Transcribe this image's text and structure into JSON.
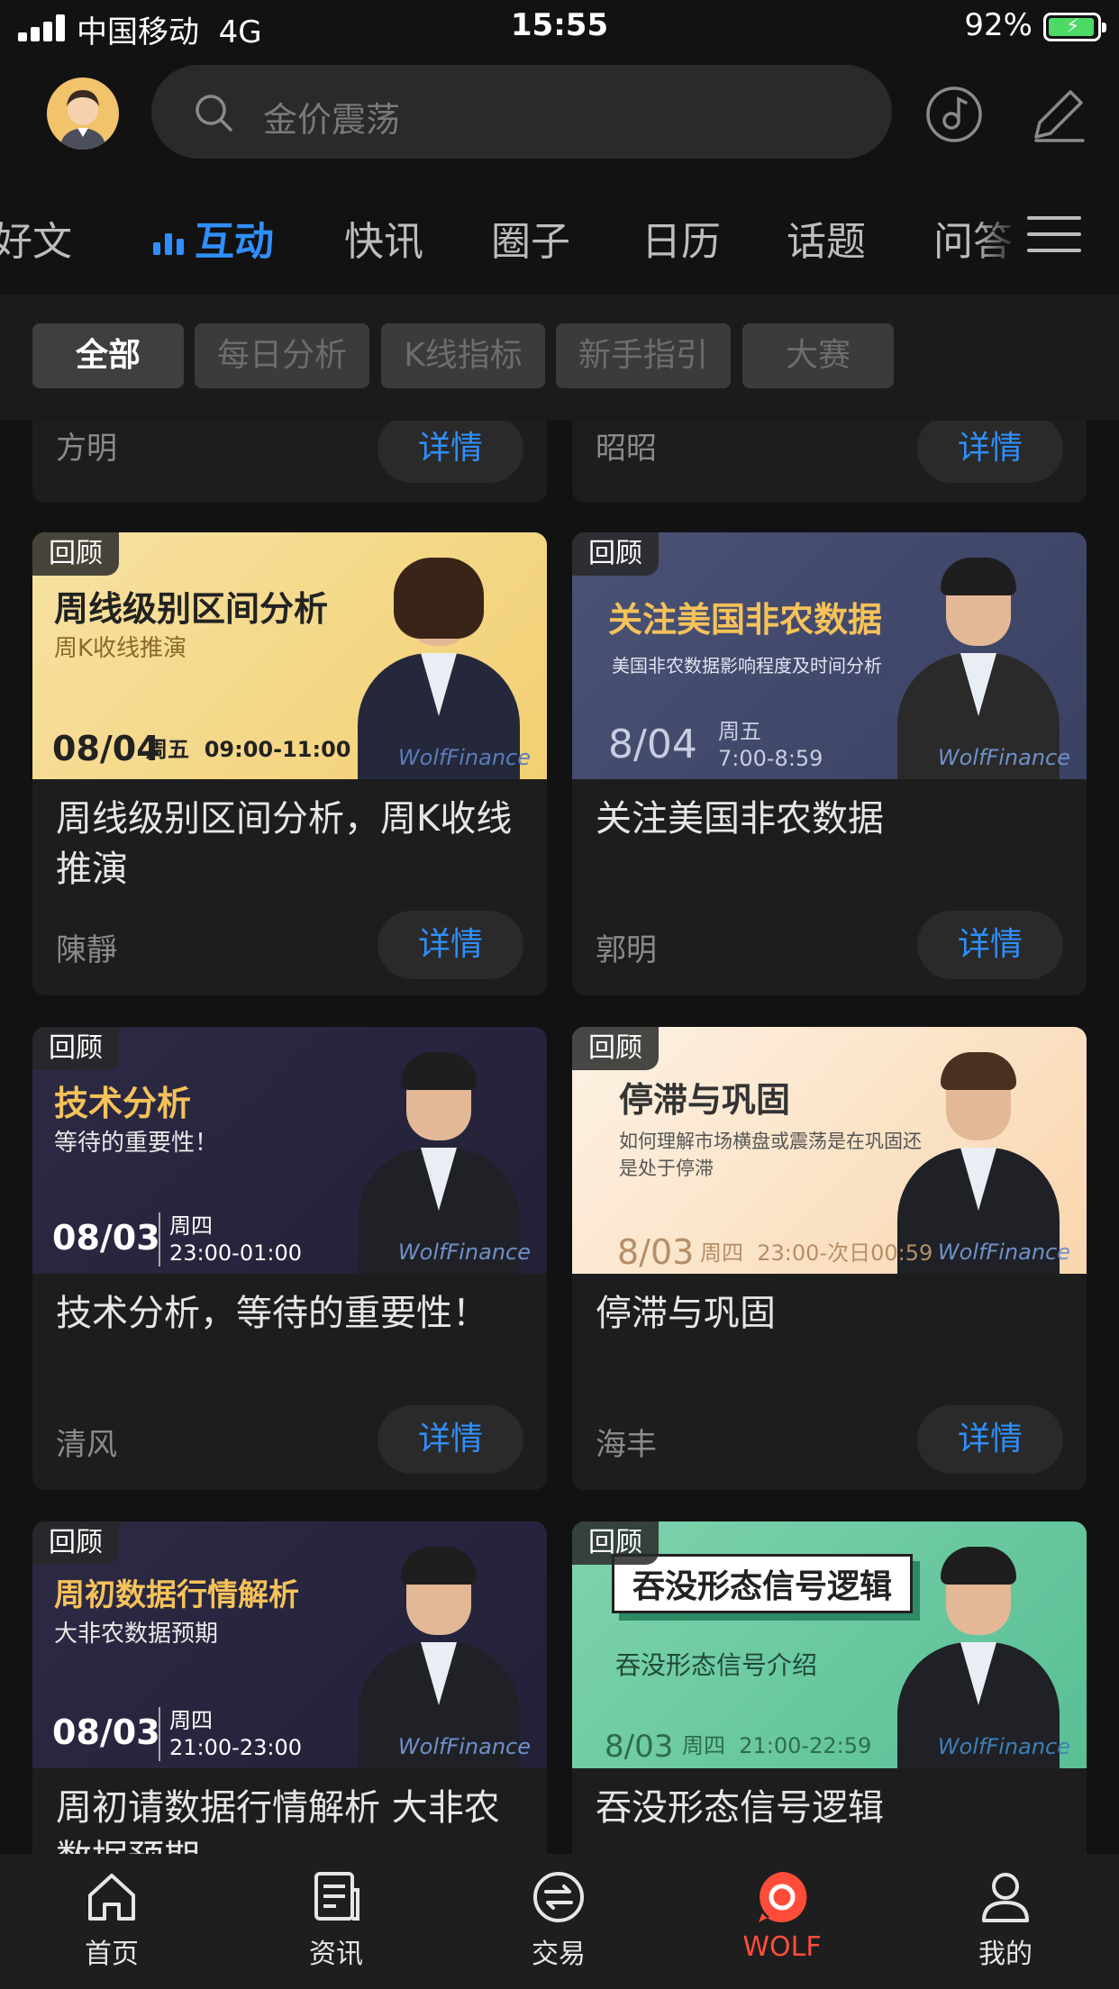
{
  "status_bar": {
    "carrier": "中国移动",
    "network": "4G",
    "time": "15:55",
    "battery": "92%",
    "battery_level": 0.92
  },
  "header": {
    "search_placeholder": "金价震荡"
  },
  "tabs": [
    "好文",
    "互动",
    "快讯",
    "圈子",
    "日历",
    "话题",
    "问答"
  ],
  "active_tab": "互动",
  "filters": [
    "全部",
    "每日分析",
    "K线指标",
    "新手指引",
    "大赛"
  ],
  "active_filter": "全部",
  "detail_label": "详情",
  "top_partial": [
    {
      "author": "方明"
    },
    {
      "author": "昭昭"
    }
  ],
  "cards": [
    {
      "badge": "回顾",
      "banner_title": "周线级别区间分析",
      "banner_sub": "周K收线推演",
      "banner_date": "08/04",
      "banner_day": "周五",
      "banner_time": "09:00-11:00",
      "brand": "WolfFinance",
      "title": "周线级别区间分析，周K收线推演",
      "author": "陳靜",
      "theme": "yellow"
    },
    {
      "badge": "回顾",
      "banner_title": "关注美国非农数据",
      "banner_sub": "美国非农数据影响程度及时间分析",
      "banner_date": "8/04",
      "banner_day": "周五",
      "banner_time": "7:00-8:59",
      "brand": "WolfFinance",
      "title": "关注美国非农数据",
      "author": "郭明",
      "theme": "navy"
    },
    {
      "badge": "回顾",
      "banner_title": "技术分析",
      "banner_sub": "等待的重要性！",
      "banner_date": "08/03",
      "banner_day": "周四",
      "banner_time": "23:00-01:00",
      "brand": "WolfFinance",
      "title": "技术分析，等待的重要性！",
      "author": "清风",
      "theme": "purple"
    },
    {
      "badge": "回顾",
      "banner_title": "停滞与巩固",
      "banner_sub": "如何理解市场横盘或震荡是在巩固还是处于停滞",
      "banner_date": "8/03",
      "banner_day": "周四",
      "banner_time": "23:00-次日00:59",
      "brand": "WolfFinance",
      "title": "停滞与巩固",
      "author": "海丰",
      "theme": "peach"
    },
    {
      "badge": "回顾",
      "banner_title": "周初数据行情解析",
      "banner_sub": "大非农数据预期",
      "banner_date": "08/03",
      "banner_day": "周四",
      "banner_time": "21:00-23:00",
      "brand": "WolfFinance",
      "title": "周初请数据行情解析 大非农数据预期",
      "author": "",
      "theme": "purple"
    },
    {
      "badge": "回顾",
      "banner_title": "吞没形态信号逻辑",
      "banner_sub": "吞没形态信号介绍",
      "banner_date": "8/03",
      "banner_day": "周四",
      "banner_time": "21:00-22:59",
      "brand": "WolfFinance",
      "title": "吞没形态信号逻辑",
      "author": "",
      "theme": "green"
    }
  ],
  "bottom_nav": [
    {
      "label": "首页",
      "icon": "home-icon"
    },
    {
      "label": "资讯",
      "icon": "news-icon"
    },
    {
      "label": "交易",
      "icon": "trade-icon"
    },
    {
      "label": "WOLF",
      "icon": "wolf-icon"
    },
    {
      "label": "我的",
      "icon": "profile-icon"
    }
  ],
  "colors": {
    "accent": "#2f8fff",
    "wolf": "#ff4d3a",
    "background": "#121212"
  }
}
